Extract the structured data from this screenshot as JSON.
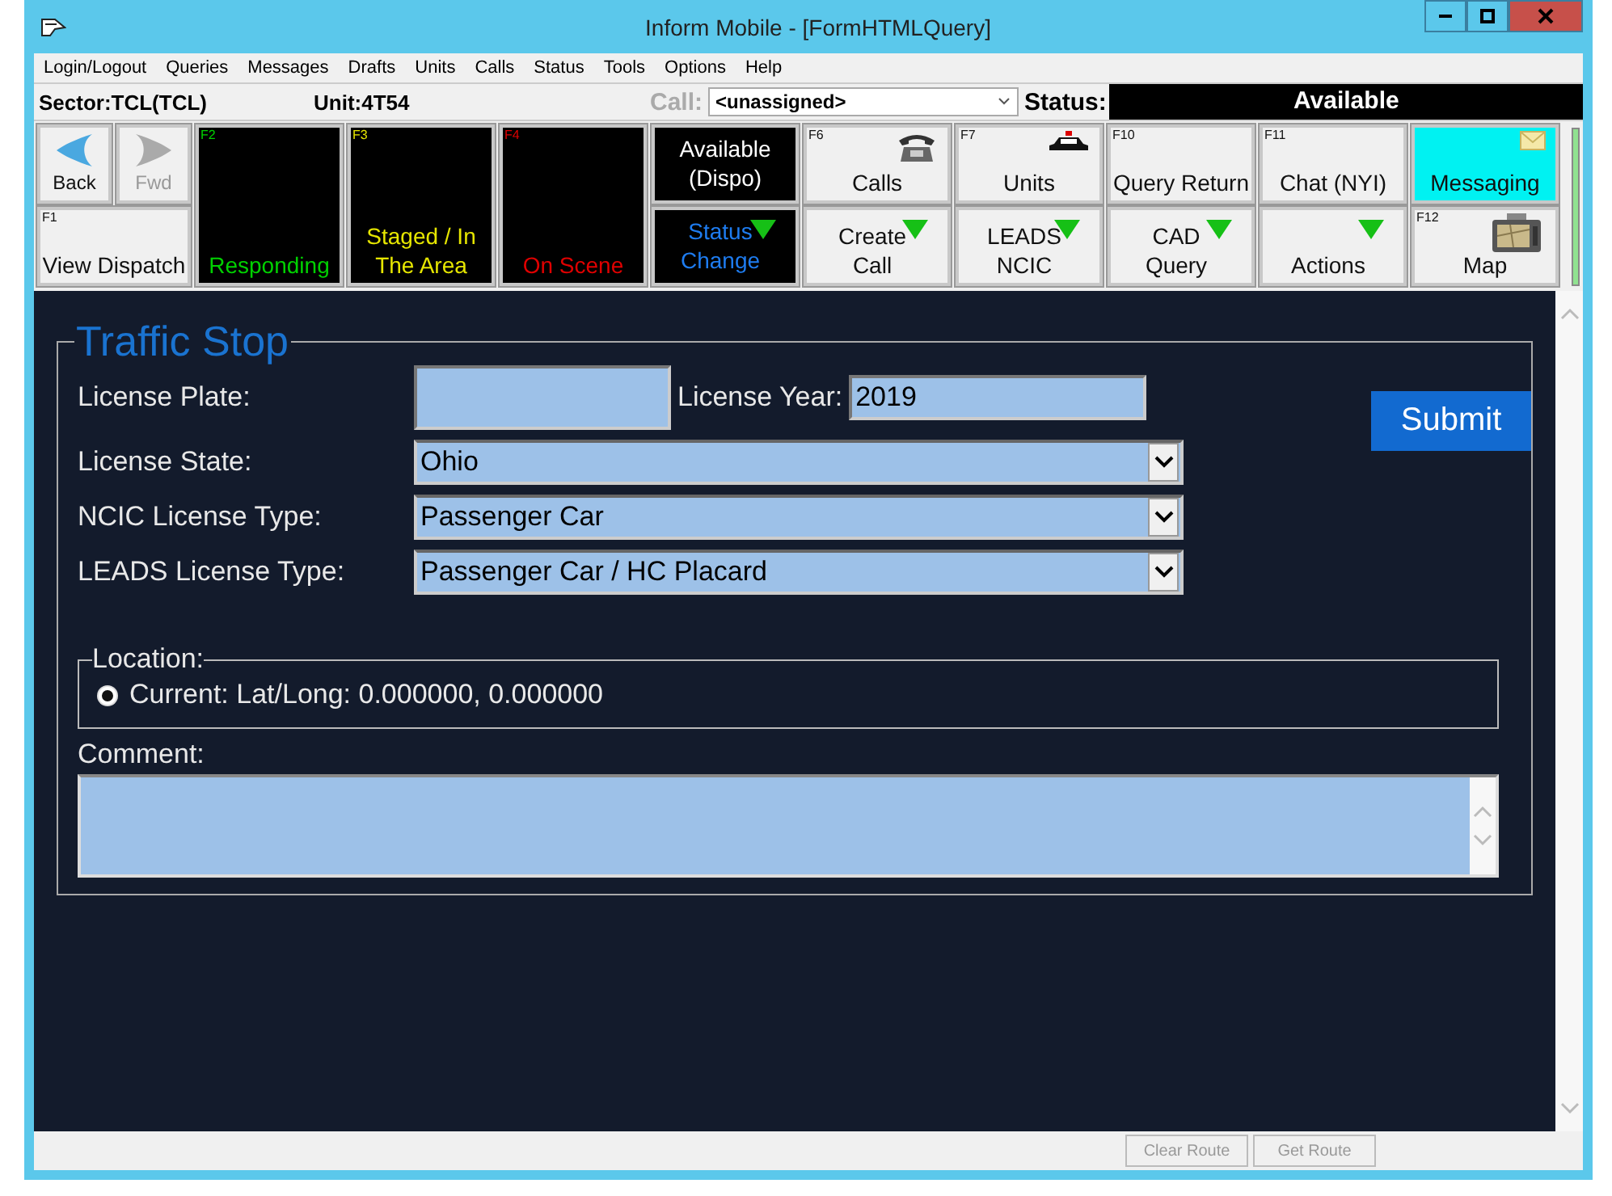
{
  "window": {
    "title": "Inform Mobile - [FormHTMLQuery]"
  },
  "menu": [
    "Login/Logout",
    "Queries",
    "Messages",
    "Drafts",
    "Units",
    "Calls",
    "Status",
    "Tools",
    "Options",
    "Help"
  ],
  "info_bar": {
    "sector": "Sector:TCL(TCL)",
    "unit": "Unit:4T54",
    "call_label": "Call:",
    "call_value": "<unassigned>",
    "status_label": "Status:",
    "status_value": "Available"
  },
  "nav_buttons": [
    {
      "label": "Back",
      "disabled": false
    },
    {
      "label": "Fwd",
      "disabled": true
    }
  ],
  "view_dispatch": {
    "key": "F1",
    "label": "View Dispatch"
  },
  "status_tiles": [
    {
      "key": "F2",
      "label": "Responding",
      "color": "#00d000"
    },
    {
      "key": "F3",
      "label": "Staged / In The Area",
      "color": "#e6e600"
    },
    {
      "key": "F4",
      "label": "On Scene",
      "color": "#e00000"
    }
  ],
  "top_buttons": [
    {
      "kind": "dark",
      "label": "Available (Dispo)",
      "color": "#ffffff",
      "highlighted": false
    },
    {
      "kind": "plain",
      "key": "F6",
      "label": "Calls",
      "highlighted": false
    },
    {
      "kind": "plain",
      "key": "F7",
      "label": "Units",
      "highlighted": false
    },
    {
      "kind": "plain",
      "key": "F10",
      "label": "Query Return",
      "highlighted": false
    },
    {
      "kind": "plain",
      "key": "F11",
      "label": "Chat (NYI)",
      "highlighted": false
    },
    {
      "kind": "plain",
      "label": "Messaging",
      "highlighted": true
    }
  ],
  "bottom_buttons": [
    {
      "kind": "dark",
      "label": "Status Change",
      "color": "#1e7cf0",
      "dropdown": true
    },
    {
      "kind": "plain",
      "label": "Create Call",
      "dropdown": true
    },
    {
      "kind": "plain",
      "label": "LEADS NCIC",
      "dropdown": true
    },
    {
      "kind": "plain",
      "label": "CAD Query",
      "dropdown": true
    },
    {
      "kind": "plain",
      "label": "Actions",
      "dropdown": true
    },
    {
      "kind": "plain",
      "key": "F12",
      "label": "Map",
      "dropdown": false
    }
  ],
  "form": {
    "title": "Traffic Stop",
    "plate_label": "License Plate:",
    "year_label": "License Year:",
    "year_value": "2019",
    "submit": "Submit",
    "selects": [
      {
        "label": "License State:",
        "value": "Ohio"
      },
      {
        "label": "NCIC License Type:",
        "value": "Passenger Car"
      },
      {
        "label": "LEADS License Type:",
        "value": "Passenger Car / HC Placard"
      }
    ],
    "location": {
      "legend": "Location:",
      "options": [
        {
          "label": "Current: Lat/Long: 0.000000, 0.000000",
          "selected": true
        }
      ]
    },
    "comment_label": "Comment:"
  },
  "footer_buttons": [
    {
      "label": "Clear Route",
      "disabled": true
    },
    {
      "label": "Get Route",
      "disabled": true
    }
  ]
}
